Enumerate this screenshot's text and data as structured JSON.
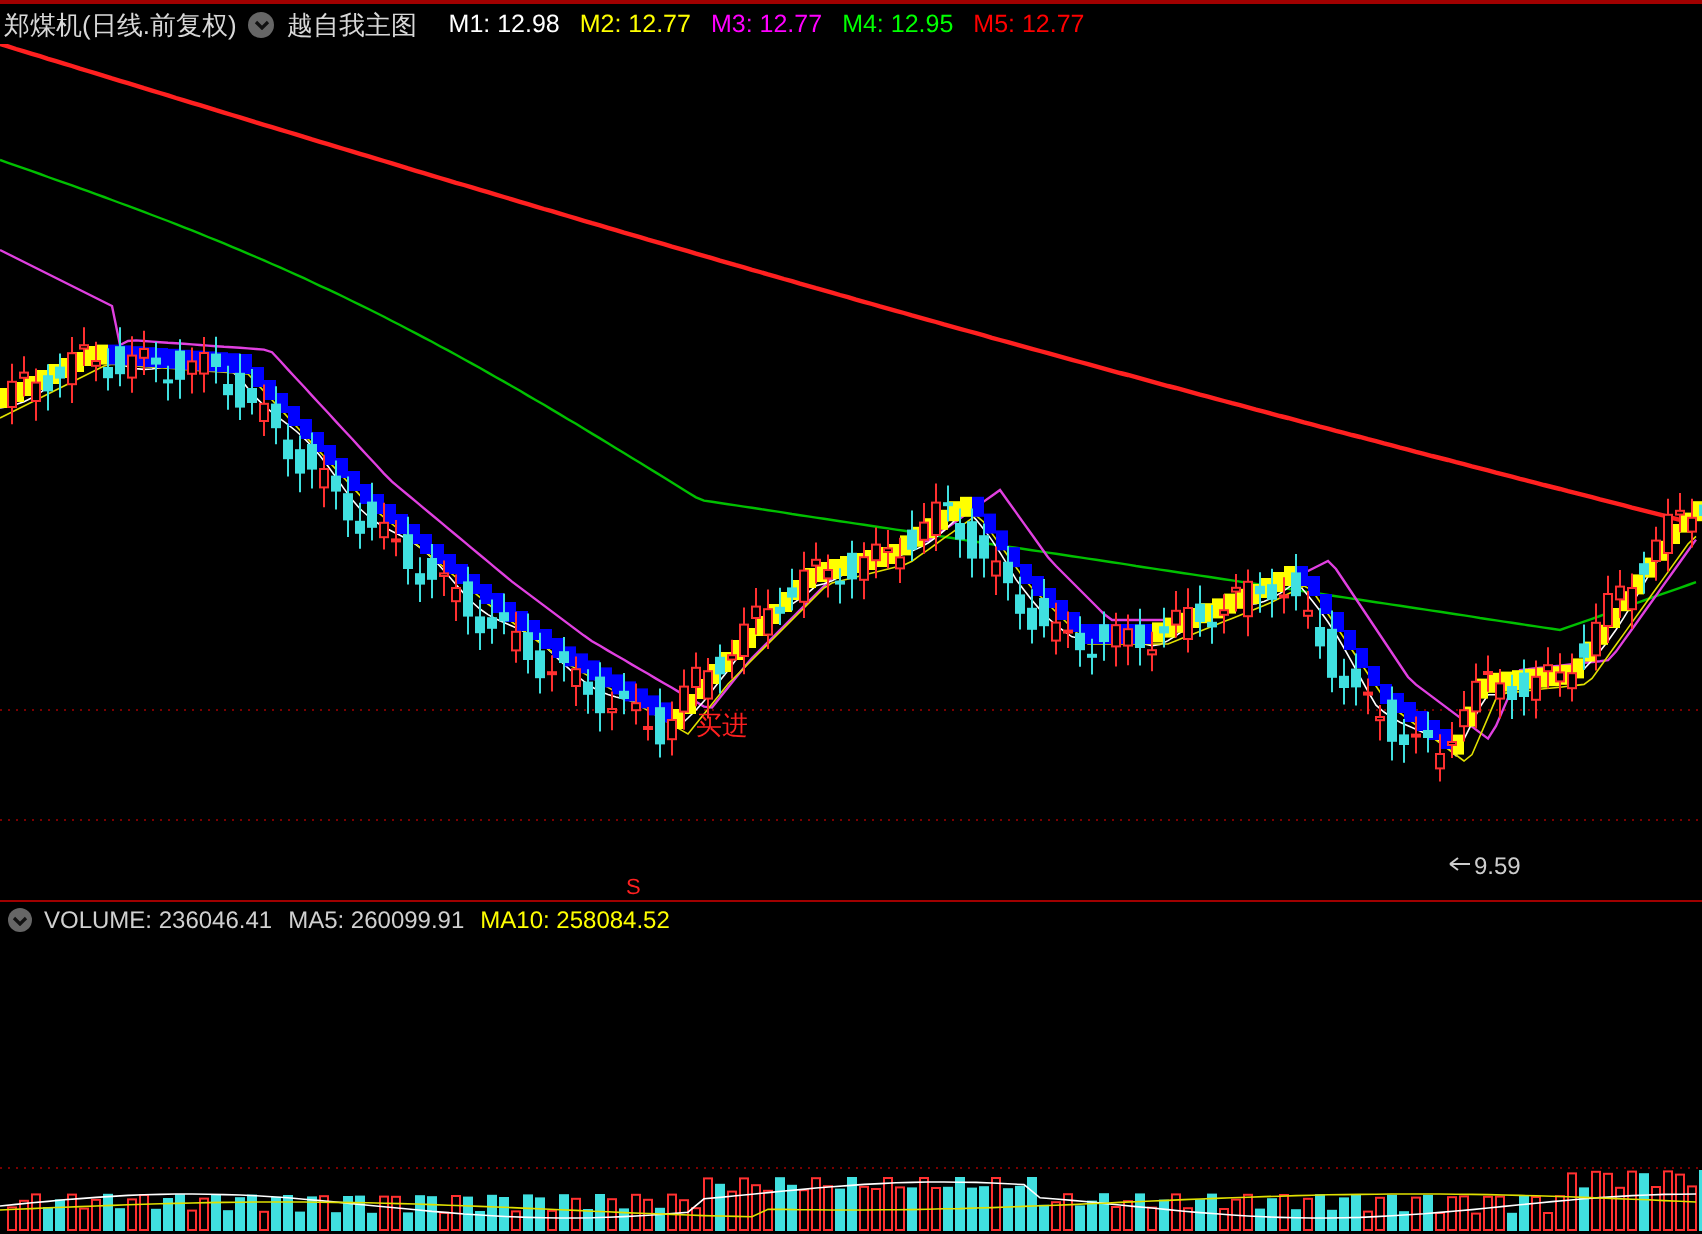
{
  "header": {
    "title": "郑煤机(日线.前复权)",
    "indicator": "越自我主图",
    "legend": [
      {
        "label": "M1:",
        "value": "12.98",
        "color": "#ffffff"
      },
      {
        "label": "M2:",
        "value": "12.77",
        "color": "#ffff00"
      },
      {
        "label": "M3:",
        "value": "12.77",
        "color": "#ff00ff"
      },
      {
        "label": "M4:",
        "value": "12.95",
        "color": "#00ff00"
      },
      {
        "label": "M5:",
        "value": "12.77",
        "color": "#ff0000"
      }
    ]
  },
  "main_chart": {
    "annotations": [
      {
        "kind": "buy",
        "text": "买进"
      },
      {
        "kind": "low",
        "text": "9.59"
      },
      {
        "kind": "signal",
        "text": "S"
      }
    ]
  },
  "volume": {
    "legend": [
      {
        "label": "VOLUME:",
        "value": "236046.41",
        "color": "#d0d0d0"
      },
      {
        "label": "MA5:",
        "value": "260099.91",
        "color": "#d0d0d0"
      },
      {
        "label": "MA10:",
        "value": "258084.52",
        "color": "#ffff00"
      }
    ]
  }
}
